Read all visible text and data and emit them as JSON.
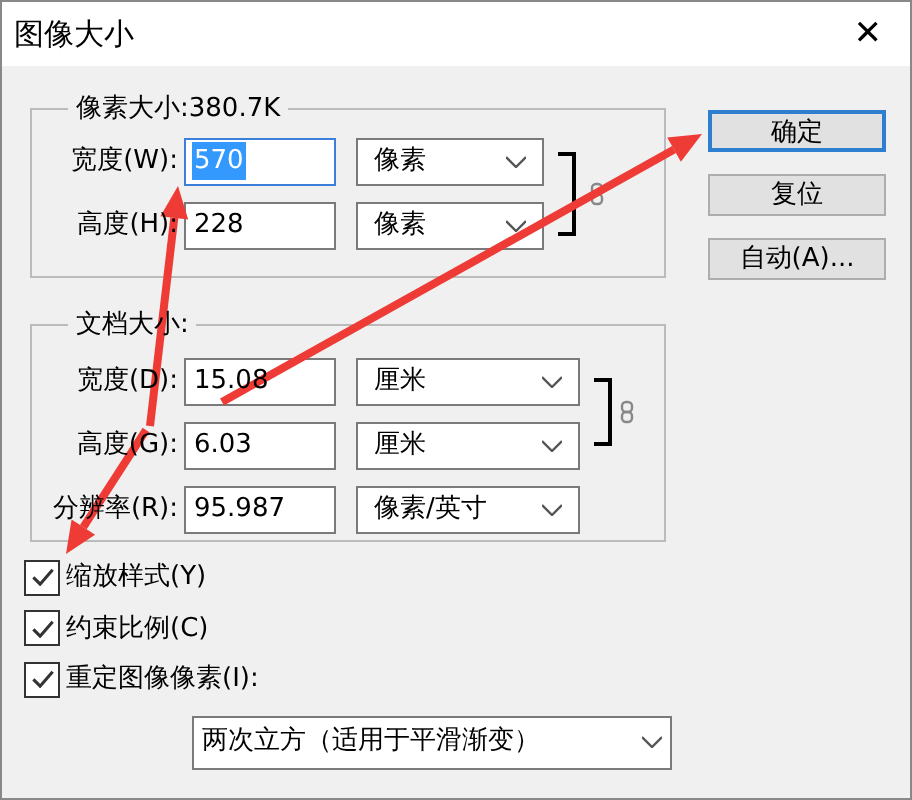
{
  "window": {
    "title": "图像大小",
    "close": "✕"
  },
  "pixel_size": {
    "title": "像素大小:380.7K",
    "rows": [
      {
        "label": "宽度(W):",
        "value": "570",
        "value_selected": true,
        "unit": "像素"
      },
      {
        "label": "高度(H):",
        "value": "228",
        "value_selected": false,
        "unit": "像素"
      }
    ]
  },
  "document_size": {
    "title": "文档大小:",
    "rows": [
      {
        "label": "宽度(D):",
        "value": "15.08",
        "unit": "厘米"
      },
      {
        "label": "高度(G):",
        "value": "6.03",
        "unit": "厘米"
      },
      {
        "label": "分辨率(R):",
        "value": "95.987",
        "unit": "像素/英寸"
      }
    ]
  },
  "buttons": [
    {
      "label": "确定",
      "default": true
    },
    {
      "label": "复位",
      "default": false
    },
    {
      "label": "自动(A)...",
      "default": false
    }
  ],
  "options": [
    {
      "label": "缩放样式(Y)",
      "checked": true
    },
    {
      "label": "约束比例(C)",
      "checked": true
    },
    {
      "label": "重定图像像素(I):",
      "checked": true
    }
  ],
  "resample": {
    "value": "两次立方（适用于平滑渐变）"
  }
}
